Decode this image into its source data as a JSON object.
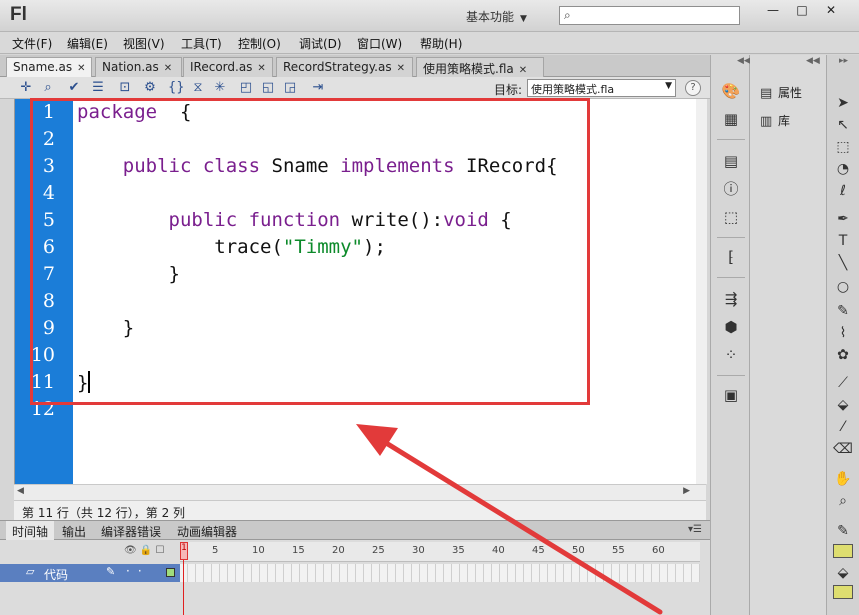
{
  "app": {
    "logo": "Fl",
    "workspace": "基本功能",
    "search_placeholder": ""
  },
  "window_controls": {
    "minimize": "—",
    "maximize": "□",
    "close": "✕"
  },
  "menu": [
    "文件(F)",
    "编辑(E)",
    "视图(V)",
    "工具(T)",
    "控制(O)",
    "调试(D)",
    "窗口(W)",
    "帮助(H)"
  ],
  "tabs": [
    {
      "label": "Sname.as",
      "active": true
    },
    {
      "label": "Nation.as",
      "active": false
    },
    {
      "label": "IRecord.as",
      "active": false
    },
    {
      "label": "RecordStrategy.as",
      "active": false
    },
    {
      "label": "使用策略模式.fla",
      "active": false
    }
  ],
  "toolbar": {
    "icons": [
      "add-statement-icon",
      "find-icon",
      "check-syntax-icon",
      "auto-format-icon",
      "code-hint-icon",
      "debug-options-icon",
      "collapse-braces-icon",
      "collapse-selection-icon",
      "expand-all-icon",
      "apply-block-comment-icon",
      "apply-line-comment-icon",
      "remove-comment-icon",
      "show-hide-toolbox-icon"
    ],
    "target_label": "目标:",
    "target_value": "使用策略模式.fla",
    "help": "?"
  },
  "editor": {
    "line_numbers": [
      "1",
      "2",
      "3",
      "4",
      "5",
      "6",
      "7",
      "8",
      "9",
      "10",
      "11",
      "12"
    ],
    "code": {
      "l1_kw": "package",
      "l1_rest": "  {",
      "l3_kw1": "public",
      "l3_kw2": "class",
      "l3_name": "Sname",
      "l3_kw3": "implements",
      "l3_iface": "IRecord{",
      "l5_kw1": "public",
      "l5_kw2": "function",
      "l5_method": "write():",
      "l5_kw3": "void",
      "l5_brace": " {",
      "l6_call": "trace(",
      "l6_str": "\"Timmy\"",
      "l6_end": ");",
      "l7": "}",
      "l9": "}",
      "l11": "}"
    }
  },
  "status": {
    "position": "第 11 行（共 12 行），第 2 列"
  },
  "panels": {
    "tabs": [
      "时间轴",
      "输出",
      "编译器错误",
      "动画编辑器"
    ],
    "active_tab": "时间轴"
  },
  "timeline": {
    "frame_numbers": [
      "5",
      "10",
      "15",
      "20",
      "25",
      "30",
      "35",
      "40",
      "45",
      "50",
      "55",
      "60"
    ],
    "playhead_frame": "1",
    "layer_name": "代码"
  },
  "props_panel": {
    "items": [
      {
        "icon": "properties-icon",
        "label": "属性"
      },
      {
        "icon": "library-icon",
        "label": "库"
      }
    ]
  },
  "colors": {
    "gutter": "#1b7dd8",
    "keyword": "#7a1f8e",
    "string": "#0c8a2a",
    "highlight": "#e23a3a",
    "layer_row": "#5a7fc0",
    "fill_swatch": "#dede70"
  }
}
